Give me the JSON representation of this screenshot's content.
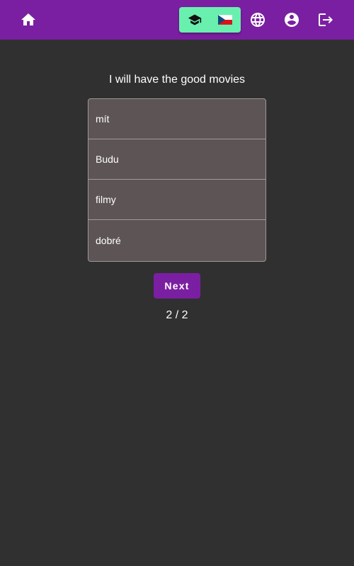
{
  "header": {
    "icons": {
      "home": "home-icon",
      "learn_mode": "school-icon",
      "language_flag": "czech-flag-icon",
      "language": "globe-icon",
      "account": "account-circle-icon",
      "logout": "logout-icon"
    },
    "colors": {
      "background": "#7b1fa2",
      "toggle_group": "#69f0ae"
    }
  },
  "exercise": {
    "prompt": "I will have the good movies",
    "options": [
      "mít",
      "Budu",
      "filmy",
      "dobré"
    ],
    "next_label": "Next",
    "progress": "2 / 2"
  },
  "theme": {
    "page_background": "#303030",
    "option_background": "#5d5555",
    "accent": "#7b1fa2"
  }
}
